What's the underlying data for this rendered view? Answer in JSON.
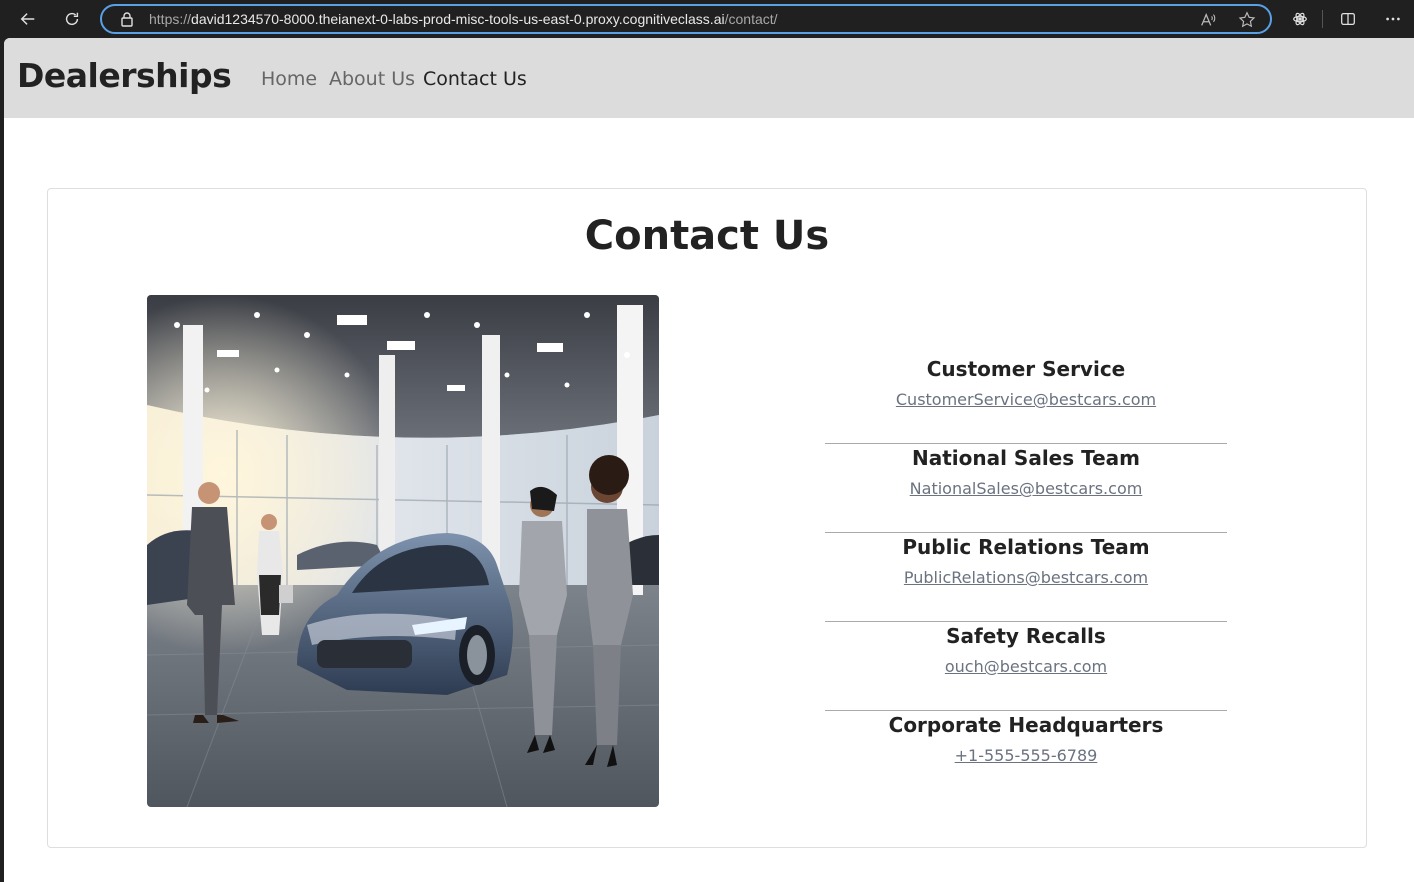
{
  "browser": {
    "url_prefix": "https://",
    "url_host": "david1234570-8000.theianext-0-labs-prod-misc-tools-us-east-0.proxy.cognitiveclass.ai",
    "url_path": "/contact/",
    "icons": [
      "back-icon",
      "refresh-icon",
      "lock-icon",
      "read-aloud-icon",
      "favorite-star-icon",
      "extensions-icon",
      "split-screen-icon",
      "more-icon"
    ]
  },
  "nav": {
    "brand": "Dealerships",
    "links": [
      {
        "label": "Home"
      },
      {
        "label": "About Us"
      },
      {
        "label": "Contact Us"
      }
    ],
    "active": "Contact Us"
  },
  "main": {
    "title": "Contact Us",
    "contacts": [
      {
        "heading": "Customer Service",
        "link": "CustomerService@bestcars.com"
      },
      {
        "heading": "National Sales Team",
        "link": "NationalSales@bestcars.com"
      },
      {
        "heading": "Public Relations Team",
        "link": "PublicRelations@bestcars.com"
      },
      {
        "heading": "Safety Recalls",
        "link": "ouch@bestcars.com"
      },
      {
        "heading": "Corporate Headquarters",
        "link": "+1-555-555-6789"
      }
    ]
  },
  "colors": {
    "accent": "#5aa0e6",
    "navbar_bg": "#dcdcdc",
    "link": "#6b7280"
  }
}
